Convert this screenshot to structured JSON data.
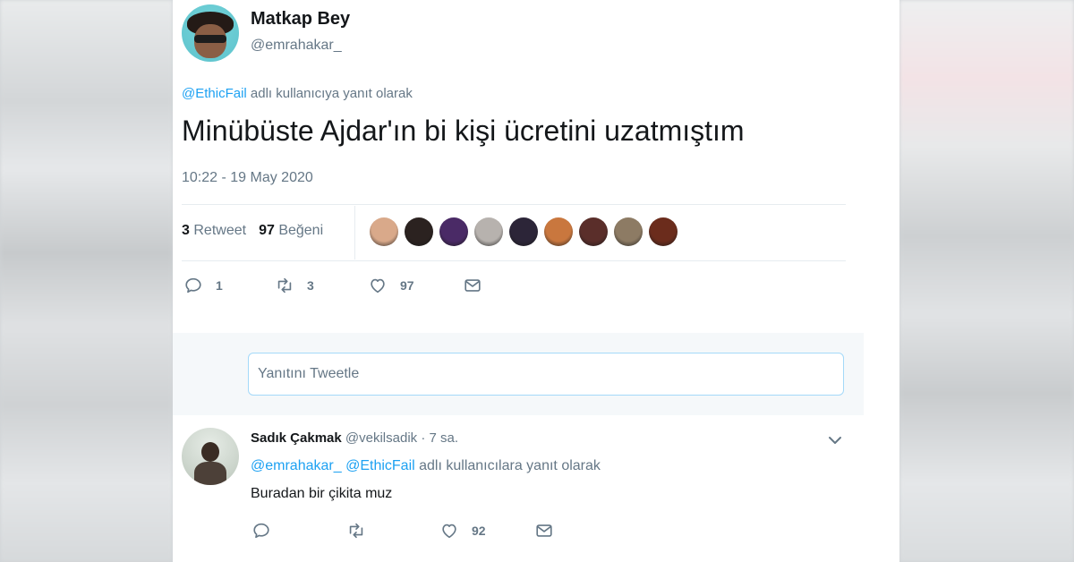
{
  "tweet": {
    "display_name": "Matkap Bey",
    "handle": "@emrahakar_",
    "reply_to_mention": "@EthicFail",
    "reply_to_suffix": " adlı kullanıcıya yanıt olarak",
    "text": "Minübüste Ajdar'ın bi kişi ücretini uzatmıştım",
    "timestamp": "10:22 - 19 May 2020",
    "retweet_count": "3",
    "retweet_label": "Retweet",
    "like_count": "97",
    "like_label": "Beğeni",
    "likers": [
      {
        "color": "#d9a98a"
      },
      {
        "color": "#2b2220"
      },
      {
        "color": "#4a2a66"
      },
      {
        "color": "#b7b2ae"
      },
      {
        "color": "#2c2538"
      },
      {
        "color": "#c9773e"
      },
      {
        "color": "#5a2e2a"
      },
      {
        "color": "#8d7b64"
      },
      {
        "color": "#6b2c1c"
      }
    ],
    "actions": {
      "reply_count": "1",
      "retweet_count": "3",
      "like_count": "97"
    }
  },
  "reply_box": {
    "placeholder": "Yanıtını Tweetle"
  },
  "reply": {
    "display_name": "Sadık Çakmak",
    "handle": "@vekilsadik",
    "dot": " · ",
    "time": "7 sa.",
    "mention_1": "@emrahakar_",
    "mention_2": "@EthicFail",
    "reply_suffix": " adlı kullanıcılara yanıt olarak",
    "text": "Buradan bir çikita muz",
    "actions": {
      "like_count": "92"
    }
  },
  "colors": {
    "link": "#1da1f2",
    "secondary_text": "#657786",
    "primary_text": "#14171a",
    "divider": "#e6ecf0"
  }
}
